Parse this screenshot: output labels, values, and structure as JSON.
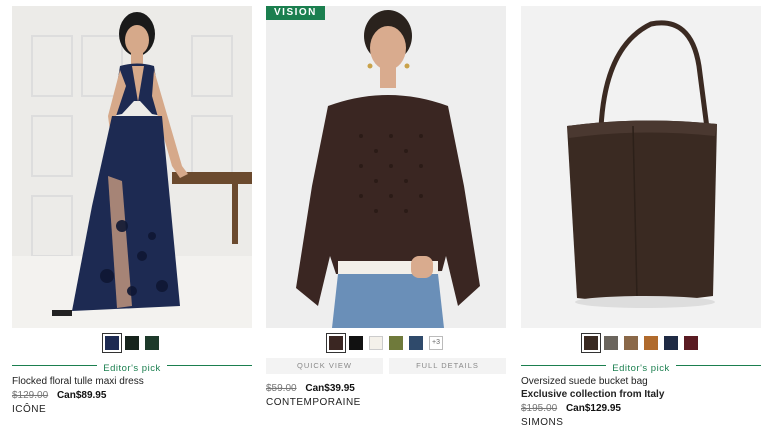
{
  "products": [
    {
      "image_alt": "model in navy flocked floral tulle maxi dress",
      "swatches": [
        {
          "color": "#1d2a52",
          "selected": true
        },
        {
          "color": "#16231c",
          "selected": false
        },
        {
          "color": "#1d3a2a",
          "selected": false
        }
      ],
      "editor_label": "Editor's pick",
      "name": "Flocked floral tulle maxi dress",
      "old_price": "$129.00",
      "new_price": "Can$89.95",
      "brand": "ICÔNE"
    },
    {
      "badge": "VISION",
      "image_alt": "model in brown textured knit sweater and jeans",
      "swatches": [
        {
          "color": "#3a2622",
          "selected": true
        },
        {
          "color": "#111111",
          "selected": false
        },
        {
          "color": "#f4f1ea",
          "selected": false
        },
        {
          "color": "#6f7a3b",
          "selected": false
        },
        {
          "color": "#2f4a6b",
          "selected": false
        }
      ],
      "more_swatches": "+3",
      "quick_view": "QUICK VIEW",
      "full_details": "FULL DETAILS",
      "old_price": "$59.00",
      "new_price": "Can$39.95",
      "brand": "CONTEMPORAINE"
    },
    {
      "image_alt": "oversized brown suede bucket bag",
      "swatches": [
        {
          "color": "#3a2a22",
          "selected": true
        },
        {
          "color": "#6b655d",
          "selected": false
        },
        {
          "color": "#8a6848",
          "selected": false
        },
        {
          "color": "#b06a2c",
          "selected": false
        },
        {
          "color": "#1f2a44",
          "selected": false
        },
        {
          "color": "#5a1b22",
          "selected": false
        }
      ],
      "editor_label": "Editor's pick",
      "name": "Oversized suede bucket bag",
      "tagline": "Exclusive collection from Italy",
      "old_price": "$195.00",
      "new_price": "Can$129.95",
      "brand": "SIMONS"
    }
  ]
}
